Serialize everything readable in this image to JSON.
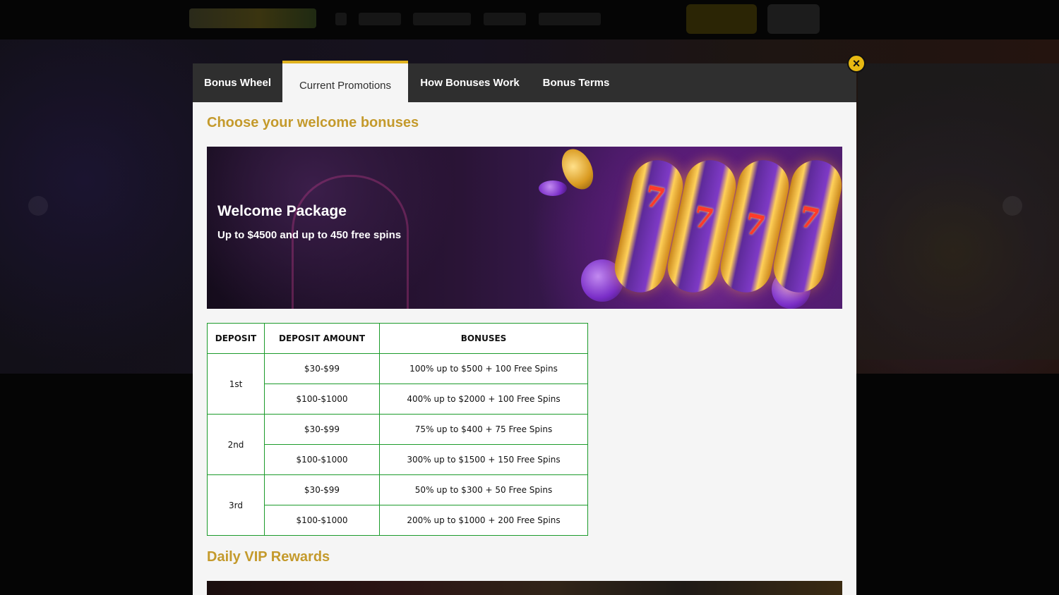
{
  "tabs": [
    {
      "label": "Bonus Wheel",
      "active": false
    },
    {
      "label": "Current Promotions",
      "active": true
    },
    {
      "label": "How Bonuses Work",
      "active": false
    },
    {
      "label": "Bonus Terms",
      "active": false
    }
  ],
  "close_icon": "×",
  "welcome": {
    "heading": "Choose your welcome bonuses",
    "banner_title": "Welcome Package",
    "banner_subtitle": "Up to $4500 and up to 450 free spins",
    "reel_symbols": [
      "7",
      "7",
      "7",
      "7"
    ]
  },
  "bonus_table": {
    "headers": [
      "DEPOSIT",
      "DEPOSIT AMOUNT",
      "BONUSES"
    ],
    "groups": [
      {
        "deposit": "1st",
        "rows": [
          {
            "amount": "$30-$99",
            "bonus": "100% up to $500 + 100 Free Spins"
          },
          {
            "amount": "$100-$1000",
            "bonus": "400% up to $2000 + 100 Free Spins"
          }
        ]
      },
      {
        "deposit": "2nd",
        "rows": [
          {
            "amount": "$30-$99",
            "bonus": "75% up to $400 + 75 Free Spins"
          },
          {
            "amount": "$100-$1000",
            "bonus": "300% up to $1500 + 150 Free Spins"
          }
        ]
      },
      {
        "deposit": "3rd",
        "rows": [
          {
            "amount": "$30-$99",
            "bonus": "50% up to $300 + 50 Free Spins"
          },
          {
            "amount": "$100-$1000",
            "bonus": "200% up to $1000 + 200 Free Spins"
          }
        ]
      }
    ]
  },
  "vip": {
    "heading": "Daily VIP Rewards"
  },
  "colors": {
    "accent_gold": "#c49a2c",
    "tab_indicator": "#e0b21f",
    "table_border": "#1c9b2b",
    "tabbar_bg": "#2f2f2f",
    "close_button": "#e8b912"
  }
}
